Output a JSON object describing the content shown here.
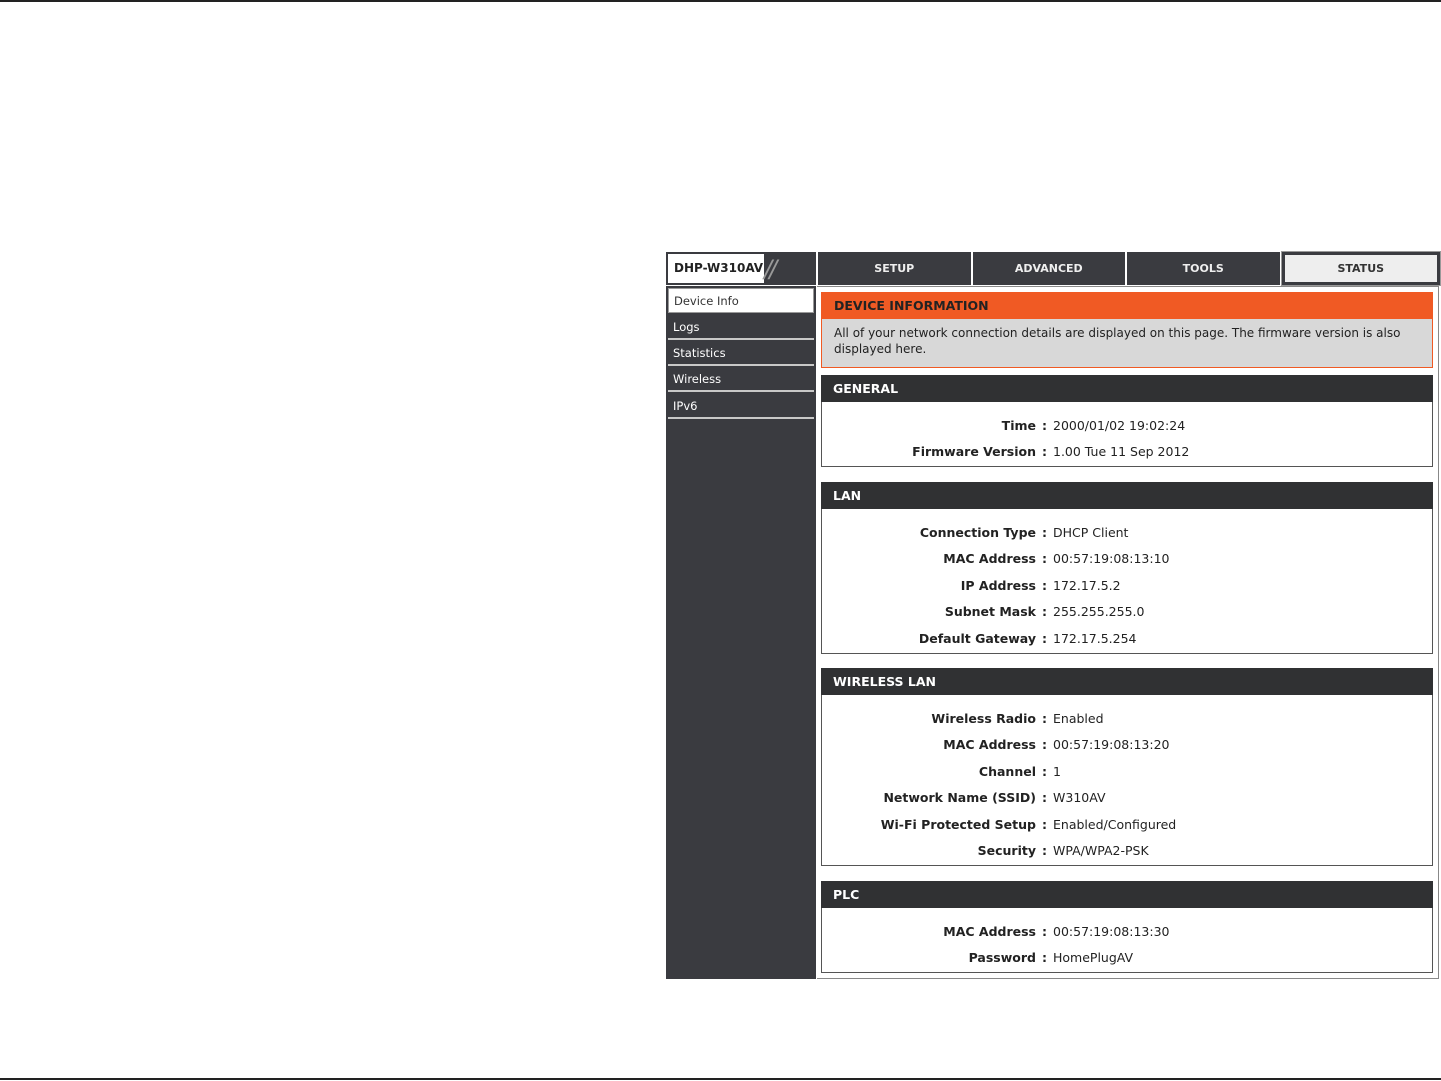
{
  "header": {
    "logo": "DHP-W310AV",
    "tabs": [
      {
        "label": "SETUP"
      },
      {
        "label": "ADVANCED"
      },
      {
        "label": "TOOLS"
      },
      {
        "label": "STATUS"
      }
    ]
  },
  "sidebar": {
    "items": [
      {
        "label": "Device Info"
      },
      {
        "label": "Logs"
      },
      {
        "label": "Statistics"
      },
      {
        "label": "Wireless"
      },
      {
        "label": "IPv6"
      }
    ]
  },
  "device_info": {
    "title": "DEVICE INFORMATION",
    "description": "All of your network connection details are displayed on this page. The firmware version is also displayed here."
  },
  "sections": [
    {
      "title": "GENERAL",
      "rows": [
        {
          "label": "Time",
          "value": "2000/01/02 19:02:24"
        },
        {
          "label": "Firmware Version",
          "value": "1.00 Tue 11 Sep 2012"
        }
      ]
    },
    {
      "title": "LAN",
      "rows": [
        {
          "label": "Connection Type",
          "value": "DHCP Client"
        },
        {
          "label": "MAC Address",
          "value": "00:57:19:08:13:10"
        },
        {
          "label": "IP Address",
          "value": "172.17.5.2"
        },
        {
          "label": "Subnet Mask",
          "value": "255.255.255.0"
        },
        {
          "label": "Default Gateway",
          "value": "172.17.5.254"
        }
      ]
    },
    {
      "title": "WIRELESS LAN",
      "rows": [
        {
          "label": "Wireless Radio",
          "value": "Enabled"
        },
        {
          "label": "MAC Address",
          "value": "00:57:19:08:13:20"
        },
        {
          "label": "Channel",
          "value": "1"
        },
        {
          "label": "Network Name (SSID)",
          "value": "W310AV"
        },
        {
          "label": "Wi-Fi Protected Setup",
          "value": "Enabled/Configured"
        },
        {
          "label": "Security",
          "value": "WPA/WPA2-PSK"
        }
      ]
    },
    {
      "title": "PLC",
      "rows": [
        {
          "label": "MAC Address",
          "value": "00:57:19:08:13:30"
        },
        {
          "label": "Password",
          "value": "HomePlugAV"
        }
      ]
    }
  ],
  "separator": ":"
}
